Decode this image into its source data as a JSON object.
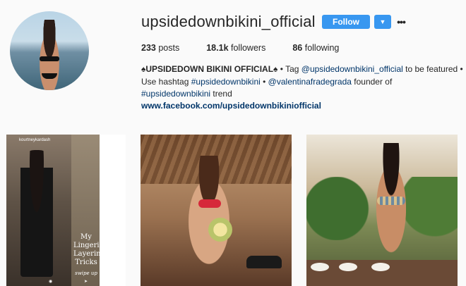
{
  "profile": {
    "username": "upsidedownbikini_official",
    "follow_label": "Follow",
    "dropdown_icon": "chevron-down-icon",
    "more_icon": "more-options-icon",
    "stats": {
      "posts_count": "233",
      "posts_label": "posts",
      "followers_count": "18.1k",
      "followers_label": "followers",
      "following_count": "86",
      "following_label": "following"
    },
    "bio": {
      "full_name": "♠UPSIDEDOWN BIKINI OFFICIAL♠",
      "text_1": " • Tag ",
      "mention_1": "@upsidedownbikini_official",
      "text_2": " to be featured • Use hashtag ",
      "hashtag_1": "#upsidedownbikini",
      "text_3": " • ",
      "mention_2": "@valentinafradegrada",
      "text_4": " founder of ",
      "hashtag_2": "#upsidedownbikini",
      "text_5": " trend"
    },
    "website": "www.facebook.com/upsidedownbikiniofficial"
  },
  "posts": {
    "post1": {
      "story_username": "kourtneykardash",
      "caption": "My Lingerie Layering Tricks",
      "swipe": "swipe up"
    }
  },
  "colors": {
    "accent": "#3897f0",
    "link": "#003569",
    "background": "#fafafa"
  }
}
